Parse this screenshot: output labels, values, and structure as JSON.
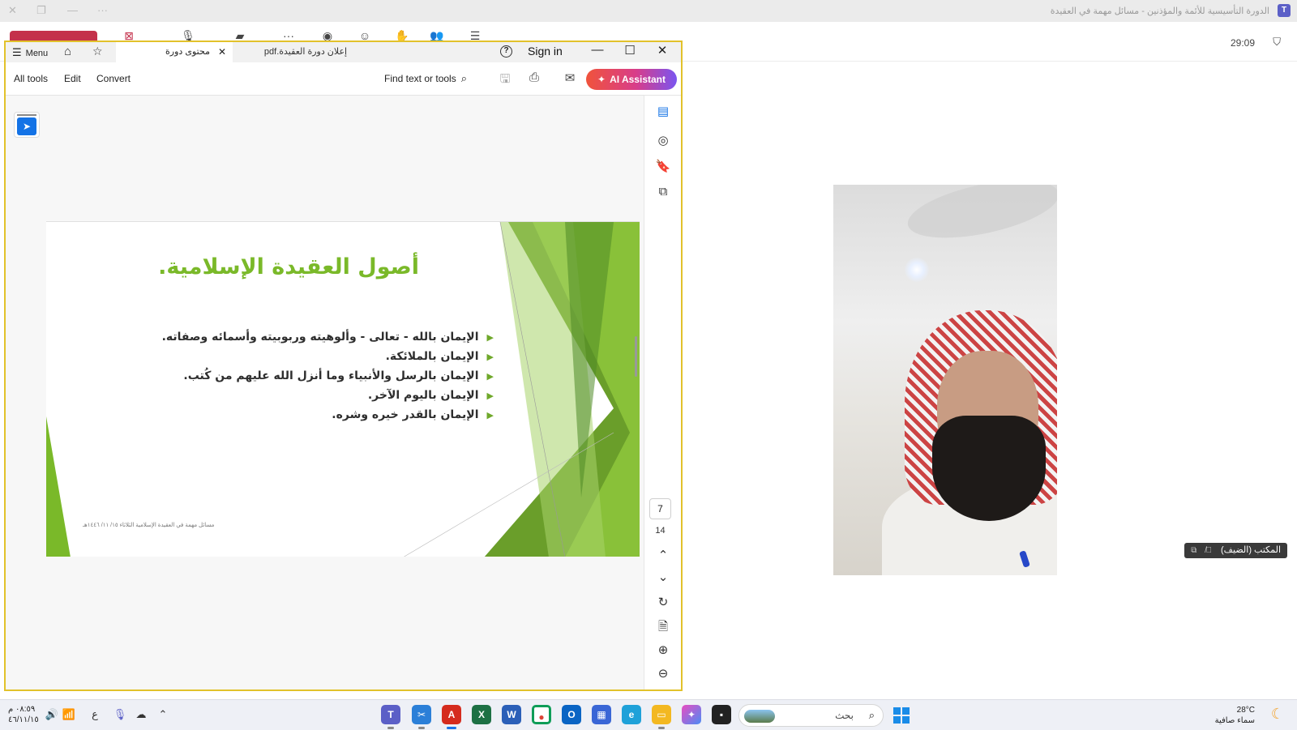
{
  "teams": {
    "meeting_title": "الدورة التأسيسية للأئمة والمؤذنين - مسائل مهمة في العقيدة",
    "logo_letter": "T",
    "timer": "29:09",
    "close_glyph": "✕",
    "restore_glyph": "❐",
    "minimize_glyph": "—",
    "more_glyph": "···"
  },
  "participant": {
    "name": "المكتب (الضيف)"
  },
  "acrobat": {
    "menu_label": "Menu",
    "tabs": [
      {
        "label": "محتوى دورة العقيدة.pdf",
        "active": true
      },
      {
        "label": "إعلان دورة العقيدة.pdf",
        "active": false
      }
    ],
    "sign_in": "Sign in",
    "toolbar": {
      "all_tools": "All tools",
      "edit": "Edit",
      "convert": "Convert",
      "find_placeholder": "Find text or tools",
      "ai_assistant": "AI Assistant"
    },
    "page_current": "7",
    "page_total": "14"
  },
  "slide": {
    "title": "أصول العقيدة الإسلامية.",
    "bullets": [
      "الإيمان بالله - تعالى - وألوهيته وربوبيته وأسمائه وصفاته.",
      "الإيمان بالملائكة.",
      "الإيمان بالرسل والأنبياء وما أنزل الله عليهم من كُتب.",
      "الإيمان باليوم الآخر.",
      "الإيمان بالقدر خيره وشره."
    ],
    "footer": "مسائل مهمة في العقيدة الإسلامية الثلاثاء ١٥/ ١١/ ١٤٤٦هـ",
    "accent_color": "#7ab929"
  },
  "taskbar": {
    "time": "٠٨:٥٩ م",
    "date": "٤٦/١١/١٥",
    "input_lang": "ع",
    "search_placeholder": "بحث",
    "weather_temp": "28°C",
    "weather_desc": "سماء صافية"
  }
}
